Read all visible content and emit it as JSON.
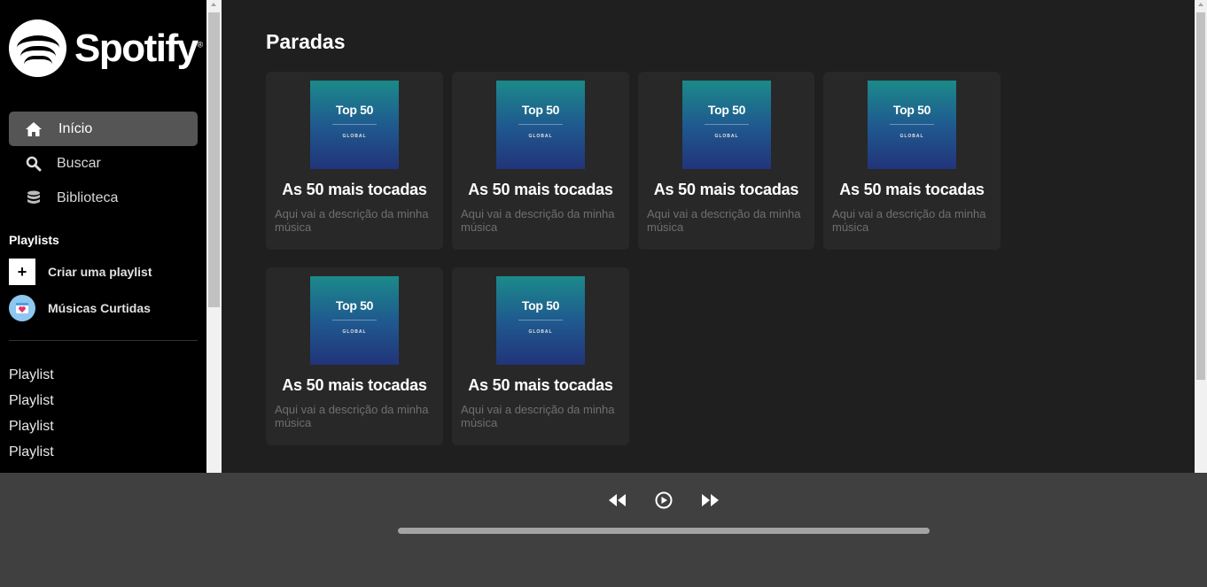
{
  "sidebar": {
    "logo_text": "Spotify",
    "logo_reg": "®",
    "nav": [
      {
        "label": "Início",
        "icon": "home-icon",
        "active": true
      },
      {
        "label": "Buscar",
        "icon": "search-icon",
        "active": false
      },
      {
        "label": "Biblioteca",
        "icon": "database-icon",
        "active": false
      }
    ],
    "playlists_title": "Playlists",
    "create_playlist_symbol": "+",
    "create_playlist_label": "Criar uma playlist",
    "liked_songs_label": "Músicas Curtidas",
    "playlist_items": [
      "Playlist",
      "Playlist",
      "Playlist",
      "Playlist"
    ]
  },
  "main": {
    "section_title": "Paradas",
    "cards": [
      {
        "cover_title": "Top 50",
        "cover_sub": "GLOBAL",
        "title": "As 50 mais tocadas",
        "description": "Aqui vai a descrição da minha música"
      },
      {
        "cover_title": "Top 50",
        "cover_sub": "GLOBAL",
        "title": "As 50 mais tocadas",
        "description": "Aqui vai a descrição da minha música"
      },
      {
        "cover_title": "Top 50",
        "cover_sub": "GLOBAL",
        "title": "As 50 mais tocadas",
        "description": "Aqui vai a descrição da minha música"
      },
      {
        "cover_title": "Top 50",
        "cover_sub": "GLOBAL",
        "title": "As 50 mais tocadas",
        "description": "Aqui vai a descrição da minha música"
      },
      {
        "cover_title": "Top 50",
        "cover_sub": "GLOBAL",
        "title": "As 50 mais tocadas",
        "description": "Aqui vai a descrição da minha música"
      },
      {
        "cover_title": "Top 50",
        "cover_sub": "GLOBAL",
        "title": "As 50 mais tocadas",
        "description": "Aqui vai a descrição da minha música"
      }
    ]
  },
  "player": {
    "controls": [
      "rewind-icon",
      "play-circle-icon",
      "fast-forward-icon"
    ]
  },
  "colors": {
    "sidebar_bg": "#000000",
    "main_bg": "#1f1f1f",
    "card_bg": "#282828",
    "player_bg": "#404040",
    "active_nav_bg": "#555555"
  }
}
